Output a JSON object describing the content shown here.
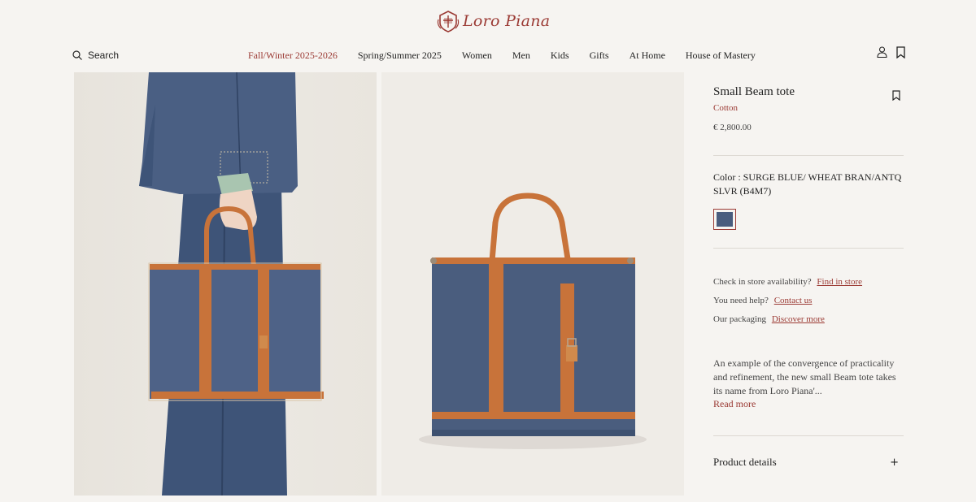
{
  "brand": {
    "name": "Loro Piana",
    "accent": "#9b3a34",
    "icon": "crest-icon"
  },
  "search": {
    "label": "Search",
    "icon": "search-icon"
  },
  "nav": [
    {
      "label": "Fall/Winter 2025-2026",
      "active": true
    },
    {
      "label": "Spring/Summer 2025"
    },
    {
      "label": "Women"
    },
    {
      "label": "Men"
    },
    {
      "label": "Kids"
    },
    {
      "label": "Gifts"
    },
    {
      "label": "At Home"
    },
    {
      "label": "House of Mastery"
    }
  ],
  "header_icons": [
    "account-icon",
    "bookmark-icon"
  ],
  "product": {
    "title": "Small Beam tote",
    "material": "Cotton",
    "price": "€ 2,800.00",
    "color_label": "Color : SURGE BLUE/ WHEAT BRAN/ANTQ SLVR (B4M7)",
    "swatch_color": "#4a5d7e",
    "store": {
      "text": "Check in store availability?",
      "link": "Find in store"
    },
    "help": {
      "text": "You need help?",
      "link": "Contact us"
    },
    "packaging": {
      "text": "Our packaging",
      "link": "Discover more"
    },
    "description": "An example of the convergence of practicality and refinement, the new small Beam tote takes its name from Loro Piana'...",
    "read_more": "Read more",
    "details_label": "Product details",
    "details_toggle": "+"
  },
  "colors": {
    "denim": "#4a5d7e",
    "leather": "#c8733a",
    "background": "#f6f4f1"
  }
}
